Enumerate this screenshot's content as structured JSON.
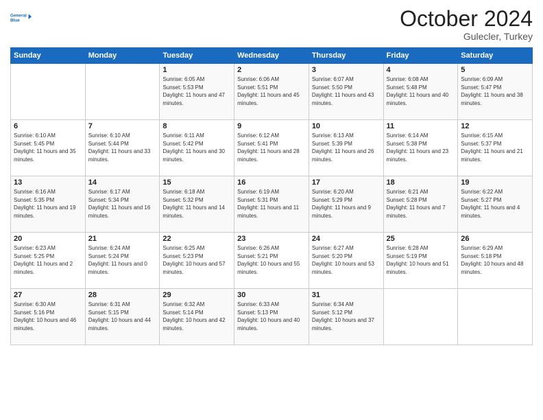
{
  "logo": {
    "line1": "General",
    "line2": "Blue"
  },
  "header": {
    "title": "October 2024",
    "subtitle": "Gulecler, Turkey"
  },
  "days_of_week": [
    "Sunday",
    "Monday",
    "Tuesday",
    "Wednesday",
    "Thursday",
    "Friday",
    "Saturday"
  ],
  "weeks": [
    [
      {
        "day": "",
        "sunrise": "",
        "sunset": "",
        "daylight": ""
      },
      {
        "day": "",
        "sunrise": "",
        "sunset": "",
        "daylight": ""
      },
      {
        "day": "1",
        "sunrise": "Sunrise: 6:05 AM",
        "sunset": "Sunset: 5:53 PM",
        "daylight": "Daylight: 11 hours and 47 minutes."
      },
      {
        "day": "2",
        "sunrise": "Sunrise: 6:06 AM",
        "sunset": "Sunset: 5:51 PM",
        "daylight": "Daylight: 11 hours and 45 minutes."
      },
      {
        "day": "3",
        "sunrise": "Sunrise: 6:07 AM",
        "sunset": "Sunset: 5:50 PM",
        "daylight": "Daylight: 11 hours and 43 minutes."
      },
      {
        "day": "4",
        "sunrise": "Sunrise: 6:08 AM",
        "sunset": "Sunset: 5:48 PM",
        "daylight": "Daylight: 11 hours and 40 minutes."
      },
      {
        "day": "5",
        "sunrise": "Sunrise: 6:09 AM",
        "sunset": "Sunset: 5:47 PM",
        "daylight": "Daylight: 11 hours and 38 minutes."
      }
    ],
    [
      {
        "day": "6",
        "sunrise": "Sunrise: 6:10 AM",
        "sunset": "Sunset: 5:45 PM",
        "daylight": "Daylight: 11 hours and 35 minutes."
      },
      {
        "day": "7",
        "sunrise": "Sunrise: 6:10 AM",
        "sunset": "Sunset: 5:44 PM",
        "daylight": "Daylight: 11 hours and 33 minutes."
      },
      {
        "day": "8",
        "sunrise": "Sunrise: 6:11 AM",
        "sunset": "Sunset: 5:42 PM",
        "daylight": "Daylight: 11 hours and 30 minutes."
      },
      {
        "day": "9",
        "sunrise": "Sunrise: 6:12 AM",
        "sunset": "Sunset: 5:41 PM",
        "daylight": "Daylight: 11 hours and 28 minutes."
      },
      {
        "day": "10",
        "sunrise": "Sunrise: 6:13 AM",
        "sunset": "Sunset: 5:39 PM",
        "daylight": "Daylight: 11 hours and 26 minutes."
      },
      {
        "day": "11",
        "sunrise": "Sunrise: 6:14 AM",
        "sunset": "Sunset: 5:38 PM",
        "daylight": "Daylight: 11 hours and 23 minutes."
      },
      {
        "day": "12",
        "sunrise": "Sunrise: 6:15 AM",
        "sunset": "Sunset: 5:37 PM",
        "daylight": "Daylight: 11 hours and 21 minutes."
      }
    ],
    [
      {
        "day": "13",
        "sunrise": "Sunrise: 6:16 AM",
        "sunset": "Sunset: 5:35 PM",
        "daylight": "Daylight: 11 hours and 19 minutes."
      },
      {
        "day": "14",
        "sunrise": "Sunrise: 6:17 AM",
        "sunset": "Sunset: 5:34 PM",
        "daylight": "Daylight: 11 hours and 16 minutes."
      },
      {
        "day": "15",
        "sunrise": "Sunrise: 6:18 AM",
        "sunset": "Sunset: 5:32 PM",
        "daylight": "Daylight: 11 hours and 14 minutes."
      },
      {
        "day": "16",
        "sunrise": "Sunrise: 6:19 AM",
        "sunset": "Sunset: 5:31 PM",
        "daylight": "Daylight: 11 hours and 11 minutes."
      },
      {
        "day": "17",
        "sunrise": "Sunrise: 6:20 AM",
        "sunset": "Sunset: 5:29 PM",
        "daylight": "Daylight: 11 hours and 9 minutes."
      },
      {
        "day": "18",
        "sunrise": "Sunrise: 6:21 AM",
        "sunset": "Sunset: 5:28 PM",
        "daylight": "Daylight: 11 hours and 7 minutes."
      },
      {
        "day": "19",
        "sunrise": "Sunrise: 6:22 AM",
        "sunset": "Sunset: 5:27 PM",
        "daylight": "Daylight: 11 hours and 4 minutes."
      }
    ],
    [
      {
        "day": "20",
        "sunrise": "Sunrise: 6:23 AM",
        "sunset": "Sunset: 5:25 PM",
        "daylight": "Daylight: 11 hours and 2 minutes."
      },
      {
        "day": "21",
        "sunrise": "Sunrise: 6:24 AM",
        "sunset": "Sunset: 5:24 PM",
        "daylight": "Daylight: 11 hours and 0 minutes."
      },
      {
        "day": "22",
        "sunrise": "Sunrise: 6:25 AM",
        "sunset": "Sunset: 5:23 PM",
        "daylight": "Daylight: 10 hours and 57 minutes."
      },
      {
        "day": "23",
        "sunrise": "Sunrise: 6:26 AM",
        "sunset": "Sunset: 5:21 PM",
        "daylight": "Daylight: 10 hours and 55 minutes."
      },
      {
        "day": "24",
        "sunrise": "Sunrise: 6:27 AM",
        "sunset": "Sunset: 5:20 PM",
        "daylight": "Daylight: 10 hours and 53 minutes."
      },
      {
        "day": "25",
        "sunrise": "Sunrise: 6:28 AM",
        "sunset": "Sunset: 5:19 PM",
        "daylight": "Daylight: 10 hours and 51 minutes."
      },
      {
        "day": "26",
        "sunrise": "Sunrise: 6:29 AM",
        "sunset": "Sunset: 5:18 PM",
        "daylight": "Daylight: 10 hours and 48 minutes."
      }
    ],
    [
      {
        "day": "27",
        "sunrise": "Sunrise: 6:30 AM",
        "sunset": "Sunset: 5:16 PM",
        "daylight": "Daylight: 10 hours and 46 minutes."
      },
      {
        "day": "28",
        "sunrise": "Sunrise: 6:31 AM",
        "sunset": "Sunset: 5:15 PM",
        "daylight": "Daylight: 10 hours and 44 minutes."
      },
      {
        "day": "29",
        "sunrise": "Sunrise: 6:32 AM",
        "sunset": "Sunset: 5:14 PM",
        "daylight": "Daylight: 10 hours and 42 minutes."
      },
      {
        "day": "30",
        "sunrise": "Sunrise: 6:33 AM",
        "sunset": "Sunset: 5:13 PM",
        "daylight": "Daylight: 10 hours and 40 minutes."
      },
      {
        "day": "31",
        "sunrise": "Sunrise: 6:34 AM",
        "sunset": "Sunset: 5:12 PM",
        "daylight": "Daylight: 10 hours and 37 minutes."
      },
      {
        "day": "",
        "sunrise": "",
        "sunset": "",
        "daylight": ""
      },
      {
        "day": "",
        "sunrise": "",
        "sunset": "",
        "daylight": ""
      }
    ]
  ]
}
